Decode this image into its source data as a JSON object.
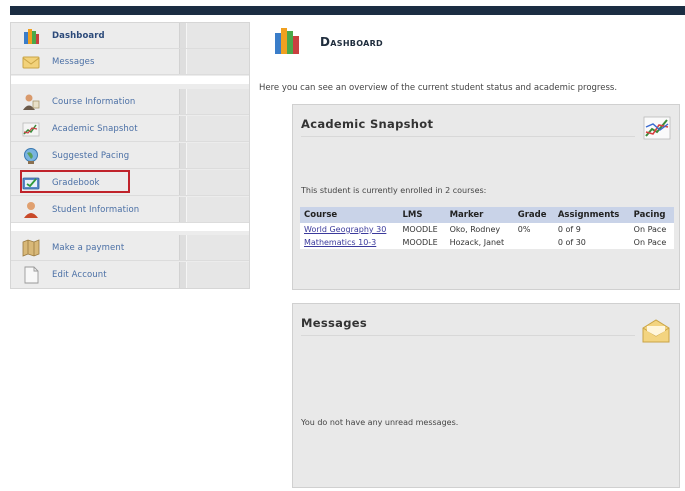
{
  "sidebar": {
    "items": [
      {
        "label": "Dashboard",
        "icon": "books-icon"
      },
      {
        "label": "Messages",
        "icon": "envelope-icon"
      },
      {
        "label": "Course Information",
        "icon": "person-icon"
      },
      {
        "label": "Academic Snapshot",
        "icon": "chart-icon"
      },
      {
        "label": "Suggested Pacing",
        "icon": "globe-icon"
      },
      {
        "label": "Gradebook",
        "icon": "gradebook-icon"
      },
      {
        "label": "Student Information",
        "icon": "student-icon"
      },
      {
        "label": "Make a payment",
        "icon": "map-icon"
      },
      {
        "label": "Edit Account",
        "icon": "document-icon"
      }
    ]
  },
  "main": {
    "title": "Dashboard",
    "intro": "Here you can see an overview of the current student status and academic progress."
  },
  "snapshot": {
    "title": "Academic Snapshot",
    "enrolled": "This student is currently enrolled in 2 courses:",
    "columns": [
      "Course",
      "LMS",
      "Marker",
      "Grade",
      "Assignments",
      "Pacing"
    ],
    "rows": [
      [
        "World Geography 30",
        "MOODLE",
        "Oko, Rodney",
        "0%",
        "0 of 9",
        "On Pace"
      ],
      [
        "Mathematics 10-3",
        "MOODLE",
        "Hozack, Janet",
        "",
        "0 of 30",
        "On Pace"
      ]
    ]
  },
  "messages": {
    "title": "Messages",
    "empty": "You do not have any unread messages."
  },
  "colors": {
    "topbar": "#1b2d42",
    "link": "#4a6fa5",
    "highlight": "#c0232b",
    "table_header": "#c9d3e8"
  }
}
